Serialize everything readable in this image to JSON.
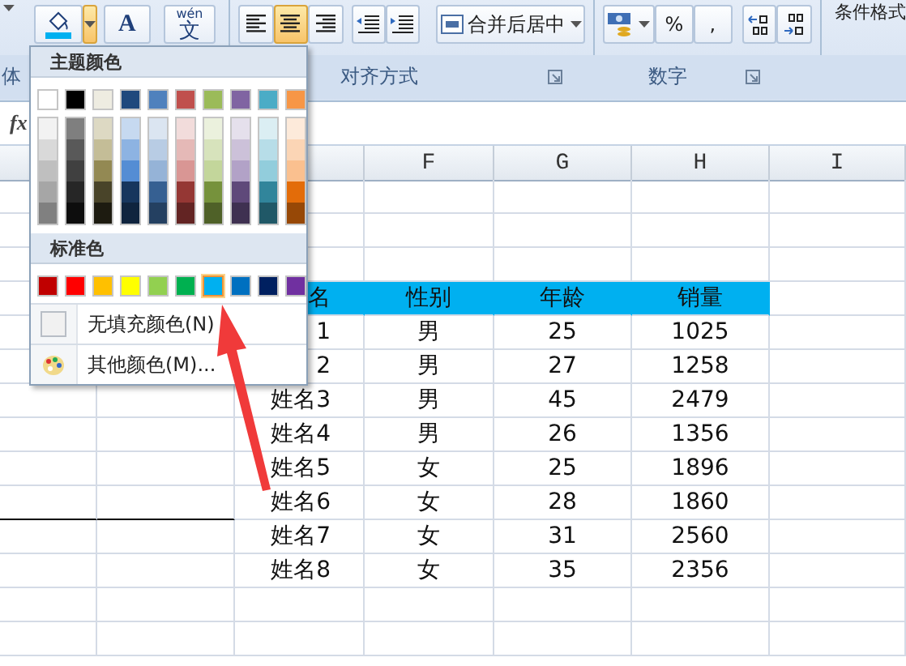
{
  "ribbon": {
    "font_group_label": "体",
    "font_color_letter": "A",
    "phonetic_button": {
      "ruby": "wén",
      "char": "文"
    },
    "alignment_buttons": [
      {
        "kind": "left",
        "selected": false
      },
      {
        "kind": "center",
        "selected": true
      },
      {
        "kind": "right",
        "selected": false
      }
    ],
    "merge_button": "合并后居中",
    "number_buttons": [
      "%",
      ","
    ],
    "groups": [
      "对齐方式",
      "数字"
    ],
    "conditional_format": "条件格式"
  },
  "formula_bar": {
    "fx": "fx"
  },
  "column_headers": [
    "F",
    "G",
    "H",
    "I"
  ],
  "table": {
    "header": [
      "名",
      "性别",
      "年龄",
      "销量"
    ],
    "rows": [
      [
        "1",
        "男",
        "25",
        "1025"
      ],
      [
        "2",
        "男",
        "27",
        "1258"
      ],
      [
        "姓名3",
        "男",
        "45",
        "2479"
      ],
      [
        "姓名4",
        "男",
        "26",
        "1356"
      ],
      [
        "姓名5",
        "女",
        "25",
        "1896"
      ],
      [
        "姓名6",
        "女",
        "28",
        "1860"
      ],
      [
        "姓名7",
        "女",
        "31",
        "2560"
      ],
      [
        "姓名8",
        "女",
        "35",
        "2356"
      ]
    ]
  },
  "color_menu": {
    "theme_title": "主题颜色",
    "theme_colors": [
      {
        "color": "#ffffff",
        "shades": [
          {
            "color": "#f2f2f2"
          },
          {
            "color": "#d9d9d9"
          },
          {
            "color": "#bfbfbf"
          },
          {
            "color": "#a6a6a6"
          },
          {
            "color": "#808080"
          }
        ]
      },
      {
        "color": "#000000",
        "shades": [
          {
            "color": "#7f7f7f"
          },
          {
            "color": "#595959"
          },
          {
            "color": "#404040"
          },
          {
            "color": "#262626"
          },
          {
            "color": "#0d0d0d"
          }
        ]
      },
      {
        "color": "#eeece1",
        "shades": [
          {
            "color": "#ddd9c3"
          },
          {
            "color": "#c4bd97"
          },
          {
            "color": "#938953"
          },
          {
            "color": "#494429"
          },
          {
            "color": "#1d1b10"
          }
        ]
      },
      {
        "color": "#1f497d",
        "shades": [
          {
            "color": "#c6d9f0"
          },
          {
            "color": "#8db3e2"
          },
          {
            "color": "#548dd4"
          },
          {
            "color": "#17365d"
          },
          {
            "color": "#0f243e"
          }
        ]
      },
      {
        "color": "#4f81bd",
        "shades": [
          {
            "color": "#dbe5f1"
          },
          {
            "color": "#b8cce4"
          },
          {
            "color": "#95b3d7"
          },
          {
            "color": "#366092"
          },
          {
            "color": "#244061"
          }
        ]
      },
      {
        "color": "#c0504d",
        "shades": [
          {
            "color": "#f2dcdb"
          },
          {
            "color": "#e5b9b7"
          },
          {
            "color": "#d99694"
          },
          {
            "color": "#953734"
          },
          {
            "color": "#632423"
          }
        ]
      },
      {
        "color": "#9bbb59",
        "shades": [
          {
            "color": "#ebf1dd"
          },
          {
            "color": "#d7e3bc"
          },
          {
            "color": "#c3d69b"
          },
          {
            "color": "#76923c"
          },
          {
            "color": "#4f6128"
          }
        ]
      },
      {
        "color": "#8064a2",
        "shades": [
          {
            "color": "#e5e0ec"
          },
          {
            "color": "#ccc1d9"
          },
          {
            "color": "#b2a2c7"
          },
          {
            "color": "#5f497a"
          },
          {
            "color": "#3f3151"
          }
        ]
      },
      {
        "color": "#4bacc6",
        "shades": [
          {
            "color": "#dbeef3"
          },
          {
            "color": "#b7dde8"
          },
          {
            "color": "#92cddc"
          },
          {
            "color": "#31859b"
          },
          {
            "color": "#205867"
          }
        ]
      },
      {
        "color": "#f79646",
        "shades": [
          {
            "color": "#fdeada"
          },
          {
            "color": "#fbd5b5"
          },
          {
            "color": "#fac08f"
          },
          {
            "color": "#e36c09"
          },
          {
            "color": "#974806"
          }
        ]
      }
    ],
    "standard_title": "标准色",
    "standard_colors": [
      {
        "color": "#c00000",
        "selected": false
      },
      {
        "color": "#ff0000",
        "selected": false
      },
      {
        "color": "#ffc000",
        "selected": false
      },
      {
        "color": "#ffff00",
        "selected": false
      },
      {
        "color": "#92d050",
        "selected": false
      },
      {
        "color": "#00b050",
        "selected": false
      },
      {
        "color": "#00b0f0",
        "selected": true
      },
      {
        "color": "#0070c0",
        "selected": false
      },
      {
        "color": "#002060",
        "selected": false
      },
      {
        "color": "#7030a0",
        "selected": false
      }
    ],
    "items": [
      {
        "kind": "no-fill",
        "label": "无填充颜色(N)"
      },
      {
        "kind": "more",
        "label": "其他颜色(M)..."
      }
    ]
  }
}
